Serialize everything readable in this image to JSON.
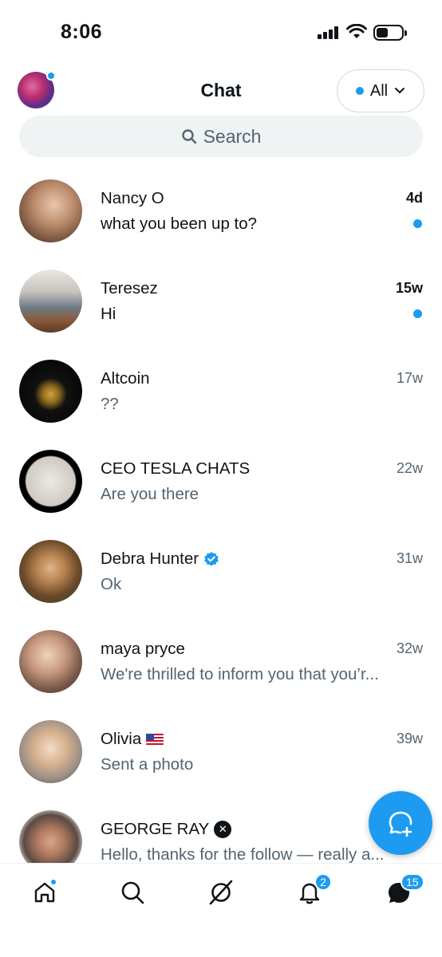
{
  "status_bar": {
    "time": "8:06"
  },
  "header": {
    "title": "Chat",
    "filter_label": "All"
  },
  "search": {
    "placeholder": "Search"
  },
  "chats": [
    {
      "name": "Nancy O",
      "preview": "what you been up to?",
      "time": "4d",
      "unread": true
    },
    {
      "name": "Teresez",
      "preview": "Hi",
      "time": "15w",
      "unread": true
    },
    {
      "name": "Altcoin",
      "preview": "??",
      "time": "17w",
      "unread": false
    },
    {
      "name": "CEO TESLA CHATS",
      "preview": "Are you there",
      "time": "22w",
      "unread": false
    },
    {
      "name": "Debra Hunter",
      "preview": "Ok",
      "time": "31w",
      "unread": false,
      "badge": "verified-check-icon"
    },
    {
      "name": "maya pryce",
      "preview": "We're thrilled to inform you that you’r...",
      "time": "32w",
      "unread": false
    },
    {
      "name": "Olivia",
      "preview": "Sent a photo",
      "time": "39w",
      "unread": false,
      "badge": "us-flag-icon"
    },
    {
      "name": "GEORGE RAY",
      "preview": "Hello, thanks for the follow — really a...",
      "time": "",
      "unread": false,
      "badge": "x-badge-icon"
    }
  ],
  "bottom_nav": {
    "notifications_count": "2",
    "messages_count": "15"
  },
  "colors": {
    "accent": "#1d9bf0",
    "text": "#0f1419",
    "secondary": "#536471",
    "search_bg": "#eff3f4"
  }
}
